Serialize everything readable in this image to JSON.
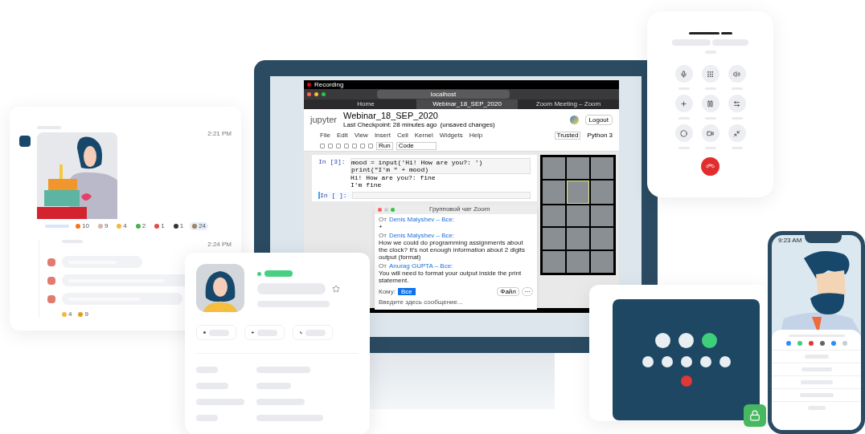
{
  "recording": {
    "label": "Recording"
  },
  "browser": {
    "address": "localhost",
    "tabs": [
      {
        "label": "Home",
        "selected": false
      },
      {
        "label": "Webinar_18_SEP_2020",
        "selected": true
      },
      {
        "label": "Zoom Meeting – Zoom",
        "selected": false
      }
    ]
  },
  "notebook": {
    "logo": "jupyter",
    "title": "Webinar_18_SEP_2020",
    "checkpoint": "Last Checkpoint: 28 minutes ago",
    "unsaved": "(unsaved changes)",
    "logout": "Logout",
    "menu": [
      "File",
      "Edit",
      "View",
      "Insert",
      "Cell",
      "Kernel",
      "Widgets",
      "Help"
    ],
    "trusted": "Trusted",
    "kernel": "Python 3",
    "run": "Run",
    "cell_type": "Code",
    "cells": [
      {
        "prompt": "In [3]:",
        "code": [
          "mood = input('Hi! How are you?: ')",
          "print(\"I'm \" + mood)"
        ],
        "output": [
          "Hi! How are you?: fine",
          "I'm fine"
        ],
        "selected": false
      },
      {
        "prompt": "In [ ]:",
        "selected": true
      }
    ]
  },
  "video_grid": {
    "tiles": [
      {
        "selected": false
      },
      {
        "selected": false
      },
      {
        "selected": false
      },
      {
        "selected": false
      },
      {
        "selected": true
      },
      {
        "selected": false
      },
      {
        "selected": false
      },
      {
        "selected": false
      },
      {
        "selected": false
      },
      {
        "selected": false
      },
      {
        "selected": false
      },
      {
        "selected": false
      },
      {
        "selected": false
      },
      {
        "selected": false
      },
      {
        "selected": false
      }
    ]
  },
  "zoom_chat": {
    "title": "Групповой чат Zoom",
    "messages": [
      {
        "from": "От",
        "sender": "Denis Malyshev – Все:",
        "text": "+"
      },
      {
        "from": "От",
        "sender": "Denis Malyshev – Все:",
        "text": "How we could do programming assignments about the clock? It's not enough information about 2 digits output (format)"
      },
      {
        "from": "От",
        "sender": "Anurag GUPTA – Все:",
        "text": "You will need to format your output inside the print statement."
      }
    ],
    "to_label": "Кому:",
    "recipient": "Все",
    "file": "Файл",
    "more": "···",
    "placeholder": "Введите здесь сообщение..."
  },
  "chat_card": {
    "time_1": "2:21 PM",
    "reactions": [
      {
        "count": "10",
        "color": "#f97316",
        "selected": false
      },
      {
        "count": "9",
        "color": "#d6b8a8",
        "selected": false
      },
      {
        "count": "4",
        "color": "#f5b83d",
        "selected": false
      },
      {
        "count": "2",
        "color": "#4caf50",
        "selected": false
      },
      {
        "count": "1",
        "color": "#e24a4a",
        "selected": false
      },
      {
        "count": "1",
        "color": "#333333",
        "selected": false
      },
      {
        "count": "24",
        "color": "#a0845c",
        "selected": true
      }
    ],
    "time_2": "2:24 PM",
    "thread_reactions": [
      {
        "count": "4",
        "color": "#f5b83d"
      },
      {
        "count": "9",
        "color": "#e0a020"
      }
    ]
  },
  "phone": {
    "time": "9:23 AM"
  }
}
